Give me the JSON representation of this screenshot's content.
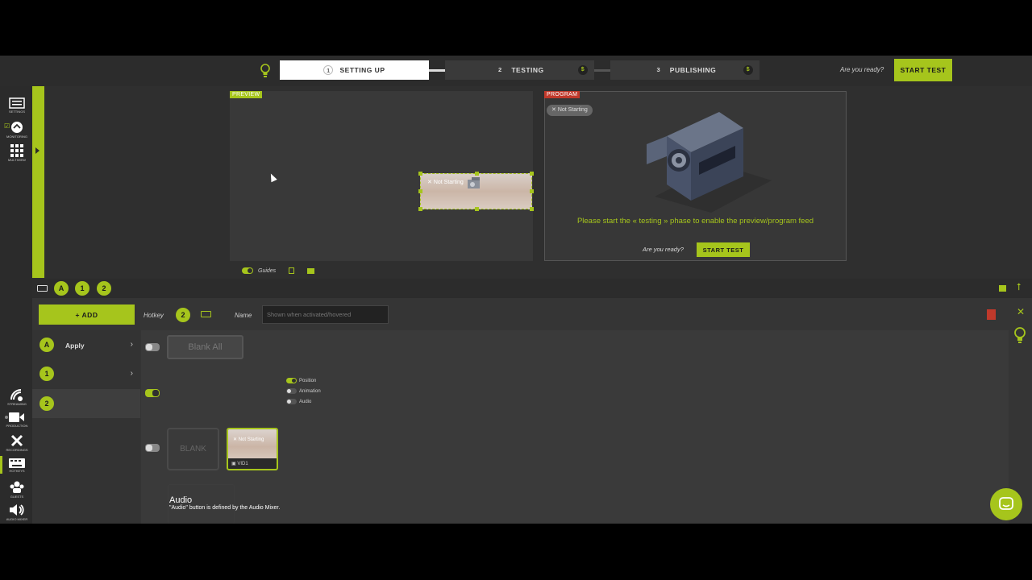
{
  "topbar": {
    "steps": [
      {
        "num": "1",
        "label": "SETTING UP"
      },
      {
        "num": "2",
        "label": "TESTING",
        "badge": "$"
      },
      {
        "num": "3",
        "label": "PUBLISHING",
        "badge": "$"
      }
    ],
    "ready_text": "Are you ready?",
    "start_test": "START TEST"
  },
  "left_rail": {
    "top_items": [
      {
        "icon": "settings-icon",
        "label": "SETTINGS"
      },
      {
        "icon": "monitoring-icon",
        "label": "MONITORING"
      },
      {
        "icon": "multiview-icon",
        "label": "MULTIVIEW"
      }
    ],
    "bottom_items": [
      {
        "icon": "streaming-icon",
        "label": "STREAMING"
      },
      {
        "icon": "production-icon",
        "label": "PRODUCTION"
      },
      {
        "icon": "recording-icon",
        "label": "RECORDINGS"
      },
      {
        "icon": "hotkeys-icon",
        "label": "HOTKEYS"
      },
      {
        "icon": "guests-icon",
        "label": "GUESTS"
      },
      {
        "icon": "audio-mixer-icon",
        "label": "AUDIO MIXER"
      }
    ]
  },
  "preview": {
    "tag": "PREVIEW",
    "source_label": "Not Starting",
    "guides_label": "Guides"
  },
  "program": {
    "tag": "PROGRAM",
    "badge": "Not Starting",
    "message": "Please start the « testing » phase to enable the preview/program feed",
    "ready_text": "Are you ready?",
    "start_test": "START TEST"
  },
  "hotkeys": {
    "tabs": [
      "A",
      "1",
      "2"
    ],
    "add_label": "+ ADD",
    "hotkey_label": "Hotkey",
    "hotkey_value": "2",
    "name_label": "Name",
    "name_placeholder": "Shown when activated/hovered",
    "list": [
      {
        "key": "A",
        "title": "Apply"
      },
      {
        "key": "1",
        "title": ""
      },
      {
        "key": "2",
        "title": ""
      }
    ],
    "blank_all": "Blank All",
    "blank": "BLANK",
    "video_card": {
      "thumb_label": "Not Starting",
      "label": "VID1"
    },
    "options": [
      "Position",
      "Animation",
      "Audio"
    ],
    "audio_title": "Audio",
    "audio_desc": "\"Audio\" button is defined by the Audio Mixer."
  },
  "colors": {
    "accent": "#a6c51c",
    "danger": "#c0392b"
  }
}
